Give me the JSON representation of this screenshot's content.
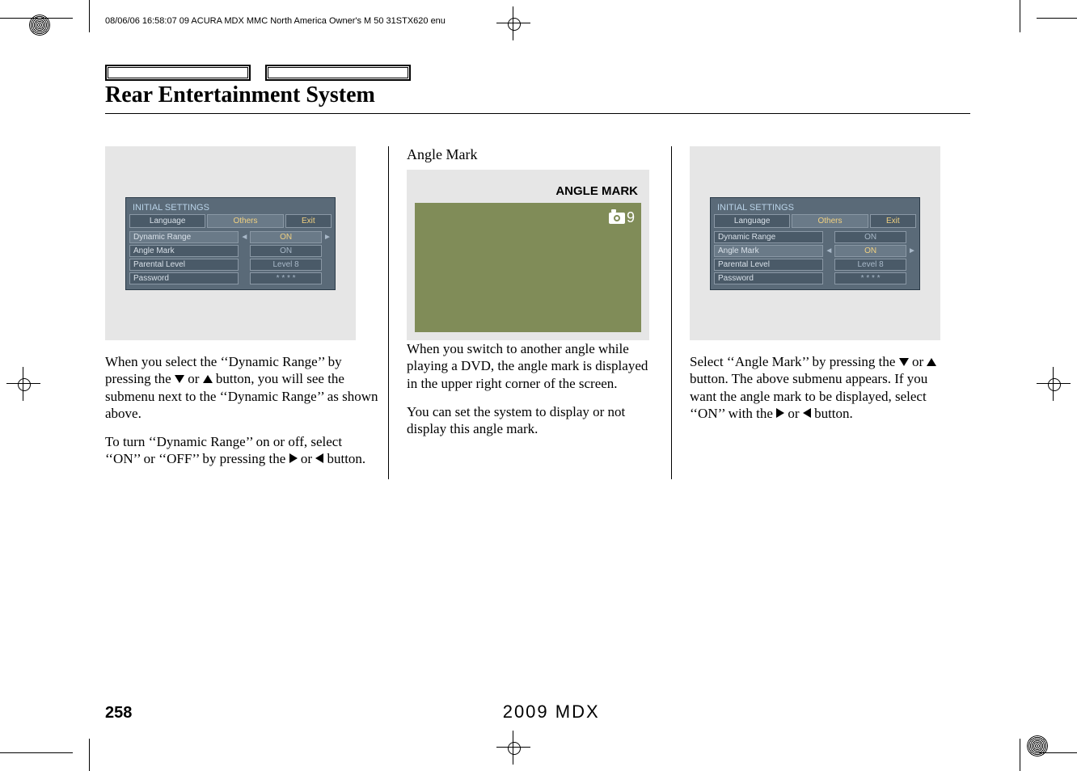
{
  "print_header": "08/06/06 16:58:07    09 ACURA MDX MMC North America Owner's M 50 31STX620 enu",
  "title": "Rear Entertainment System",
  "col1": {
    "menu": {
      "heading": "INITIAL SETTINGS",
      "tabs": {
        "language": "Language",
        "others": "Others",
        "exit": "Exit"
      },
      "rows": [
        {
          "label": "Dynamic Range",
          "value": "ON",
          "highlight": true,
          "arrows": true
        },
        {
          "label": "Angle Mark",
          "value": "ON"
        },
        {
          "label": "Parental Level",
          "value": "Level 8"
        },
        {
          "label": "Password",
          "value": "* * * *"
        }
      ]
    },
    "p1_a": "When you select the ‘‘Dynamic Range’’ by pressing the ",
    "p1_b": " or ",
    "p1_c": " button, you will see the submenu next to the ‘‘Dynamic Range’’ as shown above.",
    "p2_a": "To turn ‘‘Dynamic Range’’ on or off, select ‘‘ON’’ or ‘‘OFF’’ by pressing the ",
    "p2_b": " or ",
    "p2_c": " button."
  },
  "col2": {
    "subhead": "Angle Mark",
    "angle_label": "ANGLE MARK",
    "angle_badge": "9",
    "p1": "When you switch to another angle while playing a DVD, the angle mark is displayed in the upper right corner of the screen.",
    "p2": "You can set the system to display or not display this angle mark."
  },
  "col3": {
    "menu": {
      "heading": "INITIAL SETTINGS",
      "tabs": {
        "language": "Language",
        "others": "Others",
        "exit": "Exit"
      },
      "rows": [
        {
          "label": "Dynamic Range",
          "value": "ON"
        },
        {
          "label": "Angle Mark",
          "value": "ON",
          "highlight": true,
          "arrows": true
        },
        {
          "label": "Parental Level",
          "value": "Level 8"
        },
        {
          "label": "Password",
          "value": "* * * *"
        }
      ]
    },
    "p1_a": "Select ‘‘Angle Mark’’ by pressing the ",
    "p1_b": " or ",
    "p1_c": " button. The above submenu appears. If you want the angle mark to be displayed, select ‘‘ON’’ with the ",
    "p1_d": " or ",
    "p1_e": " button."
  },
  "footer": {
    "page": "258",
    "model": "2009  MDX"
  }
}
